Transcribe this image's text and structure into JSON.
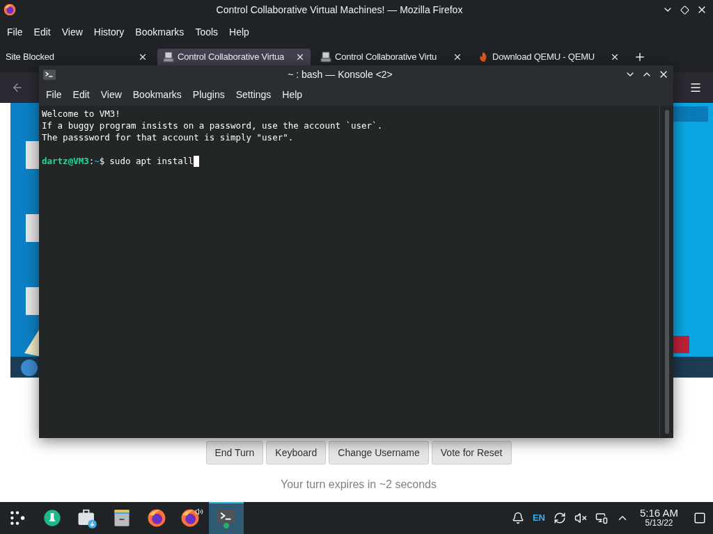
{
  "firefox": {
    "title": "Control Collaborative Virtual Machines! — Mozilla Firefox",
    "menu": [
      "File",
      "Edit",
      "View",
      "History",
      "Bookmarks",
      "Tools",
      "Help"
    ],
    "tabs": [
      {
        "label": "Site Blocked",
        "selected": false,
        "kind": "plain"
      },
      {
        "label": "Control Collaborative Virtua",
        "selected": true,
        "kind": "vm"
      },
      {
        "label": "Control Collaborative Virtu",
        "selected": false,
        "kind": "vm"
      },
      {
        "label": "Download QEMU - QEMU",
        "selected": false,
        "kind": "qemu"
      }
    ],
    "vm_screen": {
      "kind": "picture"
    },
    "buttons": [
      "End Turn",
      "Keyboard",
      "Change Username",
      "Vote for Reset"
    ],
    "turn_notice": "Your turn expires in ~2 seconds"
  },
  "konsole": {
    "title": "~ : bash — Konsole <2>",
    "menu": [
      "File",
      "Edit",
      "View",
      "Bookmarks",
      "Plugins",
      "Settings",
      "Help"
    ],
    "lines": [
      {
        "kind": "text",
        "text": "Welcome to VM3!"
      },
      {
        "kind": "text",
        "text": "If a buggy program insists on a password, use the account `user`."
      },
      {
        "kind": "text",
        "text": "The passsword for that account is simply \"user\"."
      },
      {
        "kind": "blank"
      },
      {
        "kind": "prompt",
        "user": "dartz@VM3",
        "sep": ":",
        "path": "~",
        "symbol": "$",
        "command": "sudo apt install"
      }
    ]
  },
  "taskbar": {
    "apps": [
      {
        "kind": "launcher",
        "selected": false
      },
      {
        "kind": "discover",
        "selected": false
      },
      {
        "kind": "store",
        "selected": false
      },
      {
        "kind": "files",
        "selected": false
      },
      {
        "kind": "firefox",
        "selected": false
      },
      {
        "kind": "firefox-audio",
        "selected": false
      },
      {
        "kind": "konsole",
        "selected": true
      }
    ],
    "language": "EN",
    "time": "5:16 AM",
    "date": "5/13/22"
  }
}
